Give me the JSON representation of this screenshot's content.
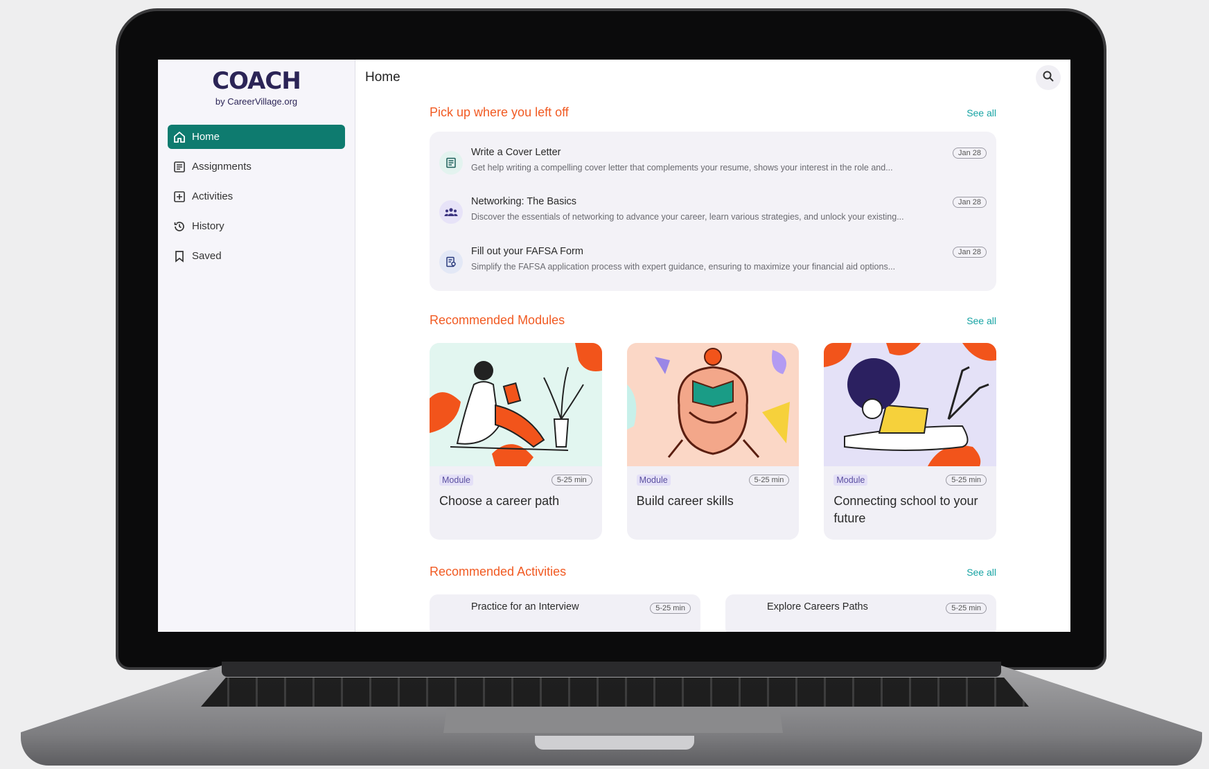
{
  "brand": {
    "name": "COACH",
    "tagline": "by CareerVillage.org"
  },
  "sidebar": {
    "items": [
      {
        "label": "Home",
        "icon": "home-icon",
        "active": true
      },
      {
        "label": "Assignments",
        "icon": "list-icon"
      },
      {
        "label": "Activities",
        "icon": "plus-box-icon"
      },
      {
        "label": "History",
        "icon": "history-icon"
      },
      {
        "label": "Saved",
        "icon": "bookmark-icon"
      }
    ]
  },
  "header": {
    "title": "Home",
    "search_icon": "search-icon"
  },
  "pickup": {
    "title": "Pick up where you left off",
    "see_all": "See all",
    "items": [
      {
        "title": "Write a Cover Letter",
        "desc": "Get help writing a compelling cover letter that complements your resume, shows your interest in the role and...",
        "date": "Jan 28",
        "icon": "document-icon"
      },
      {
        "title": "Networking: The Basics",
        "desc": "Discover the essentials of networking to advance your career, learn various strategies, and unlock your existing...",
        "date": "Jan 28",
        "icon": "people-icon"
      },
      {
        "title": "Fill out your FAFSA Form",
        "desc": "Simplify the FAFSA application process with expert guidance, ensuring to maximize your financial aid options...",
        "date": "Jan 28",
        "icon": "form-icon"
      }
    ]
  },
  "modules": {
    "title": "Recommended Modules",
    "see_all": "See all",
    "items": [
      {
        "tag": "Module",
        "duration": "5-25 min",
        "title": "Choose a career path"
      },
      {
        "tag": "Module",
        "duration": "5-25 min",
        "title": "Build career skills"
      },
      {
        "tag": "Module",
        "duration": "5-25 min",
        "title": "Connecting school to your future"
      }
    ]
  },
  "activities": {
    "title": "Recommended Activities",
    "see_all": "See all",
    "items": [
      {
        "title": "Practice for an Interview",
        "duration": "5-25 min"
      },
      {
        "title": "Explore Careers Paths",
        "duration": "5-25 min"
      }
    ]
  },
  "colors": {
    "accent": "#0e7b6f",
    "section_title": "#f15a22",
    "link": "#16a3a3",
    "brand": "#2b2456"
  }
}
